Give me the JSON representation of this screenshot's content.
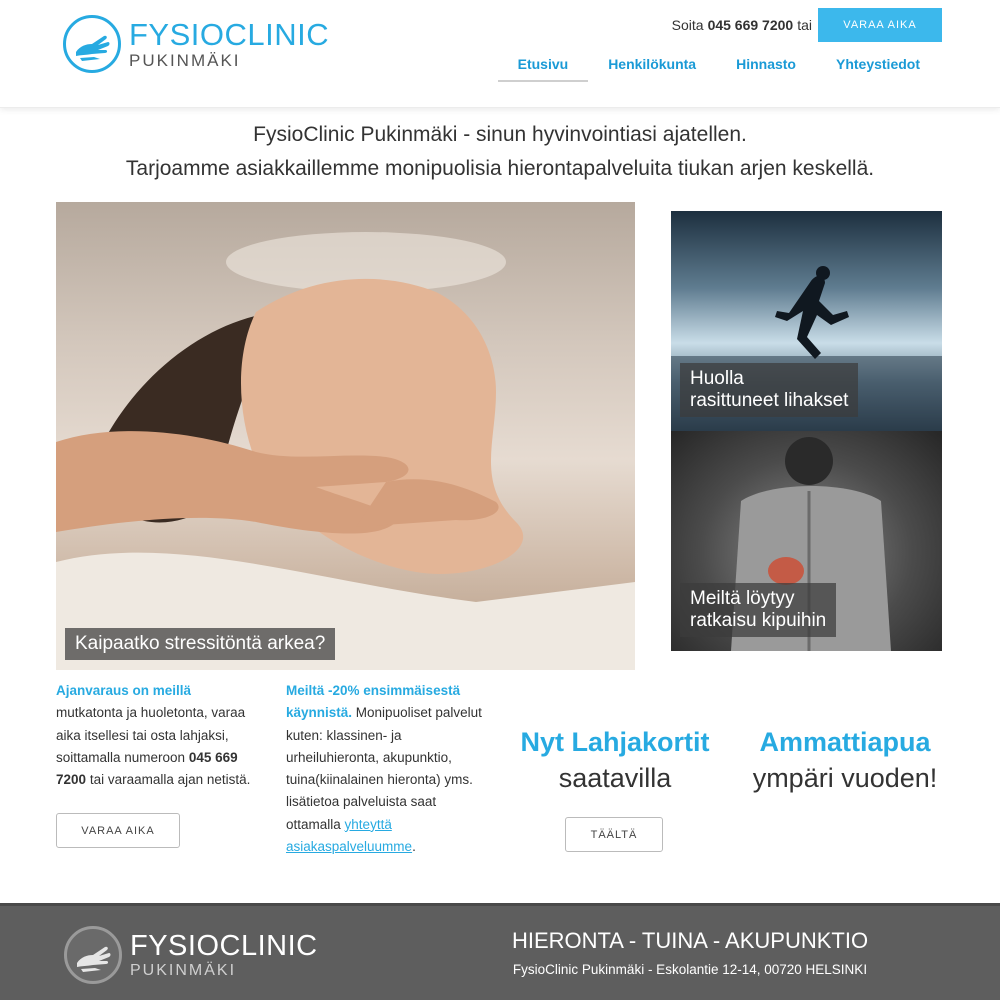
{
  "header": {
    "logo": {
      "main": "FYSIOCLINIC",
      "sub": "PUKINMÄKI"
    },
    "call_prefix": "Soita",
    "phone": "045 669 7200",
    "call_suffix": "tai",
    "book_button": "VARAA AIKA",
    "nav": [
      "Etusivu",
      "Henkilökunta",
      "Hinnasto",
      "Yhteystiedot"
    ],
    "active_nav": "Etusivu"
  },
  "intro": {
    "line1": "FysioClinic Pukinmäki - sinun hyvinvointiasi ajatellen.",
    "line2": "Tarjoamme asiakkaillemme monipuolisia hierontapalveluita tiukan arjen keskellä."
  },
  "hero": {
    "caption": "Kaipaatko stressitöntä arkea?"
  },
  "side_images": [
    {
      "caption_line1": "Huolla",
      "caption_line2": "rasittuneet lihakset"
    },
    {
      "caption_line1": "Meiltä löytyy",
      "caption_line2": "ratkaisu kipuihin"
    }
  ],
  "col1": {
    "highlight": "Ajanvaraus on meillä",
    "text1": "mutkatonta ja huoletonta, varaa aika itsellesi tai osta lahjaksi, soittamalla numeroon",
    "phone": "045 669 7200",
    "text2": "tai varaamalla ajan netistä.",
    "button": "VARAA AIKA"
  },
  "col2": {
    "highlight": "Meiltä -20% ensimmäisestä käynnistä.",
    "text1": "Monipuoliset palvelut kuten: klassinen- ja urheiluhieronta, akupunktio, tuina(kiinalainen hieronta) yms. lisätietoa palveluista saat ottamalla",
    "link": "yhteyttä asiakaspalveluumme",
    "end": "."
  },
  "promo1": {
    "title": "Nyt Lahjakortit",
    "subtitle": "saatavilla",
    "button": "TÄÄLTÄ"
  },
  "promo2": {
    "title": "Ammattiapua",
    "subtitle": "ympäri vuoden!"
  },
  "footer": {
    "logo": {
      "main": "FYSIOCLINIC",
      "sub": "PUKINMÄKI"
    },
    "tagline": "HIERONTA - TUINA - AKUPUNKTIO",
    "address": "FysioClinic Pukinmäki - Eskolantie 12-14, 00720 HELSINKI"
  },
  "colors": {
    "accent": "#27aae1",
    "button": "#3cb8ec",
    "footer": "#5e5e5e"
  },
  "icons": {
    "logo": "massage-hand-logo-icon"
  }
}
